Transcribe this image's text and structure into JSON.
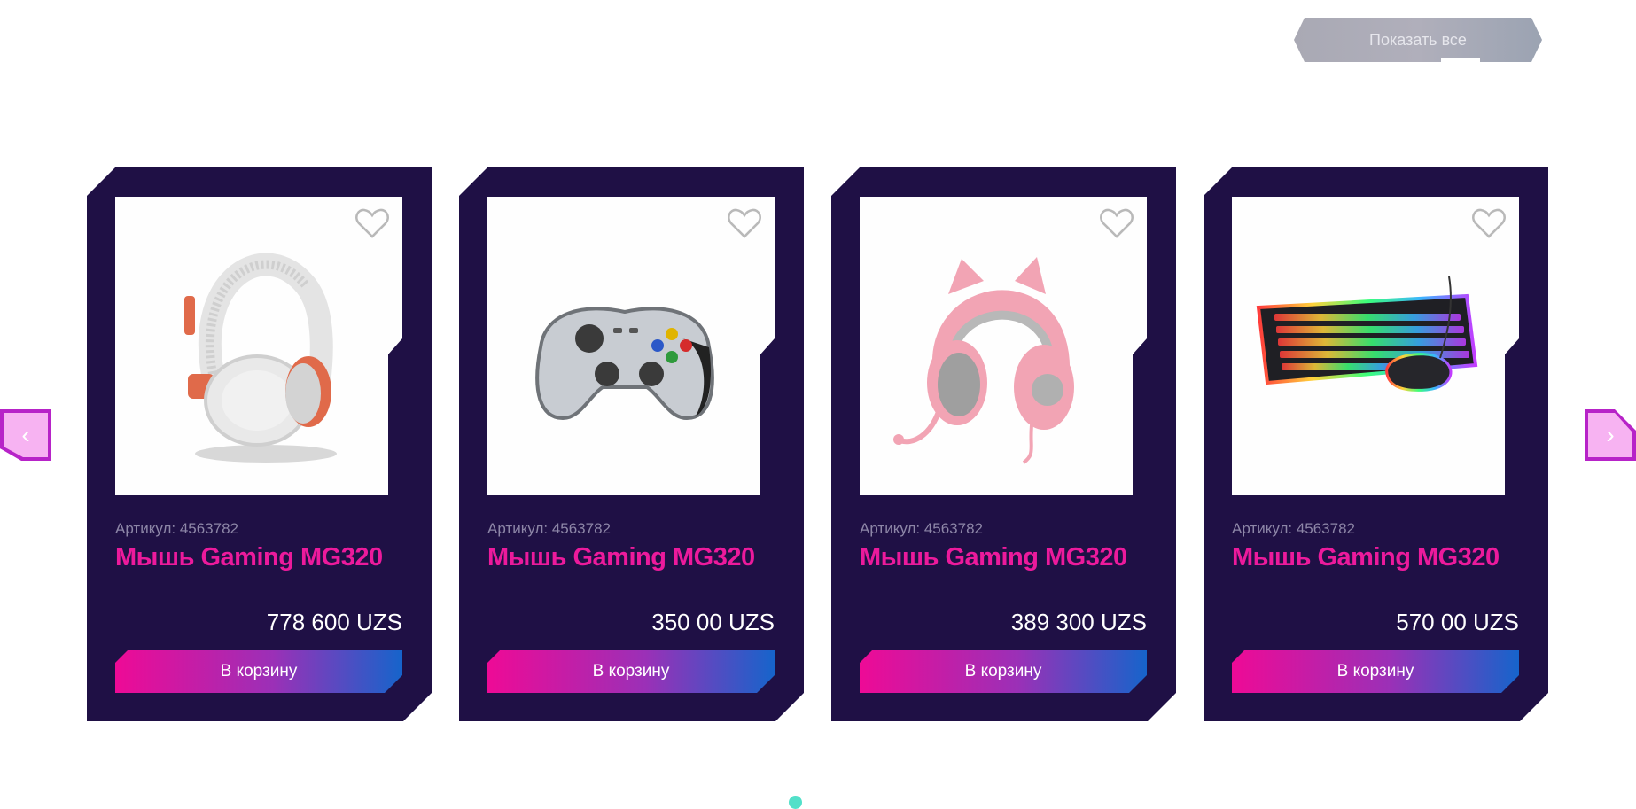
{
  "header": {
    "show_all_label": "Показать все"
  },
  "carousel": {
    "prev_label": "‹",
    "next_label": "›",
    "products": [
      {
        "image": "headphones-icon",
        "sku": "Артикул: 4563782",
        "name": "Мышь Gaming MG320",
        "price": "778 600 UZS",
        "cart_label": "В корзину"
      },
      {
        "image": "gamepad-icon",
        "sku": "Артикул: 4563782",
        "name": "Мышь Gaming MG320",
        "price": "350 00 UZS",
        "cart_label": "В корзину"
      },
      {
        "image": "cat-ear-headset-icon",
        "sku": "Артикул: 4563782",
        "name": "Мышь Gaming MG320",
        "price": "389 300 UZS",
        "cart_label": "В корзину"
      },
      {
        "image": "keyboard-mouse-icon",
        "sku": "Артикул: 4563782",
        "name": "Мышь Gaming MG320",
        "price": "570 00 UZS",
        "cart_label": "В корзину"
      }
    ]
  },
  "colors": {
    "card_bg": "#1f1045",
    "accent_pink": "#ec1a9c",
    "accent_blue": "#1664cb",
    "dot": "#52e0c9"
  }
}
